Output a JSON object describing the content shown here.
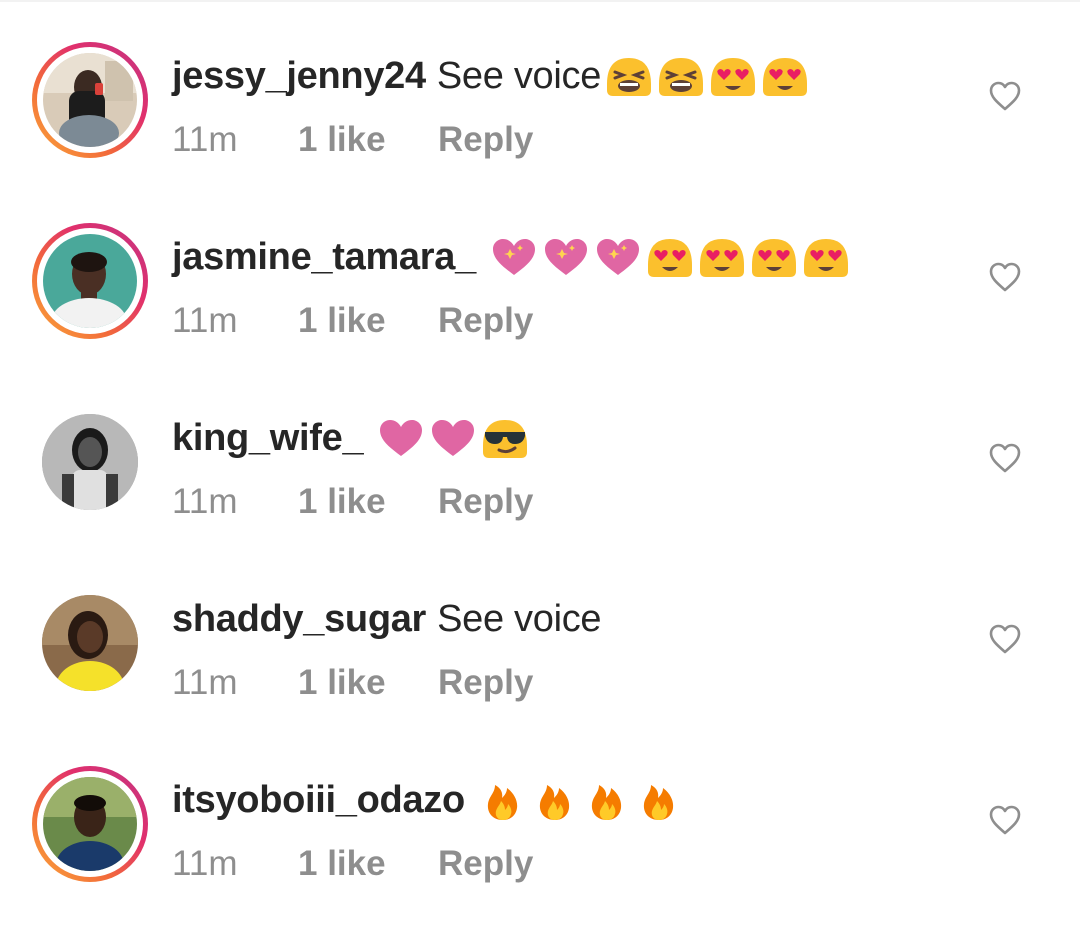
{
  "colors": {
    "text_primary": "#262626",
    "text_secondary": "#8e8e8e",
    "story_ring_start": "#fbaa3a",
    "story_ring_end": "#c13584"
  },
  "comments": [
    {
      "username": "jessy_jenny24",
      "text": "See voice",
      "emojis": [
        "tired-face-emoji",
        "tired-face-emoji",
        "heart-eyes-emoji",
        "heart-eyes-emoji"
      ],
      "time": "11m",
      "likes": "1 like",
      "reply": "Reply",
      "has_story_ring": true,
      "like_icon": "heart-outline-icon"
    },
    {
      "username": "jasmine_tamara_",
      "text": "",
      "emojis": [
        "sparkling-heart-emoji",
        "sparkling-heart-emoji",
        "sparkling-heart-emoji",
        "heart-eyes-emoji",
        "heart-eyes-emoji",
        "heart-eyes-emoji",
        "heart-eyes-emoji"
      ],
      "time": "11m",
      "likes": "1 like",
      "reply": "Reply",
      "has_story_ring": true,
      "like_icon": "heart-outline-icon"
    },
    {
      "username": "king_wife_",
      "text": "",
      "emojis": [
        "pink-heart-emoji",
        "pink-heart-emoji",
        "sunglasses-emoji"
      ],
      "time": "11m",
      "likes": "1 like",
      "reply": "Reply",
      "has_story_ring": false,
      "like_icon": "heart-outline-icon"
    },
    {
      "username": "shaddy_sugar",
      "text": "See voice",
      "emojis": [],
      "time": "11m",
      "likes": "1 like",
      "reply": "Reply",
      "has_story_ring": false,
      "like_icon": "heart-outline-icon"
    },
    {
      "username": "itsyoboiii_odazo",
      "text": "",
      "emojis": [
        "fire-emoji",
        "fire-emoji",
        "fire-emoji",
        "fire-emoji"
      ],
      "time": "11m",
      "likes": "1 like",
      "reply": "Reply",
      "has_story_ring": true,
      "like_icon": "heart-outline-icon"
    }
  ]
}
